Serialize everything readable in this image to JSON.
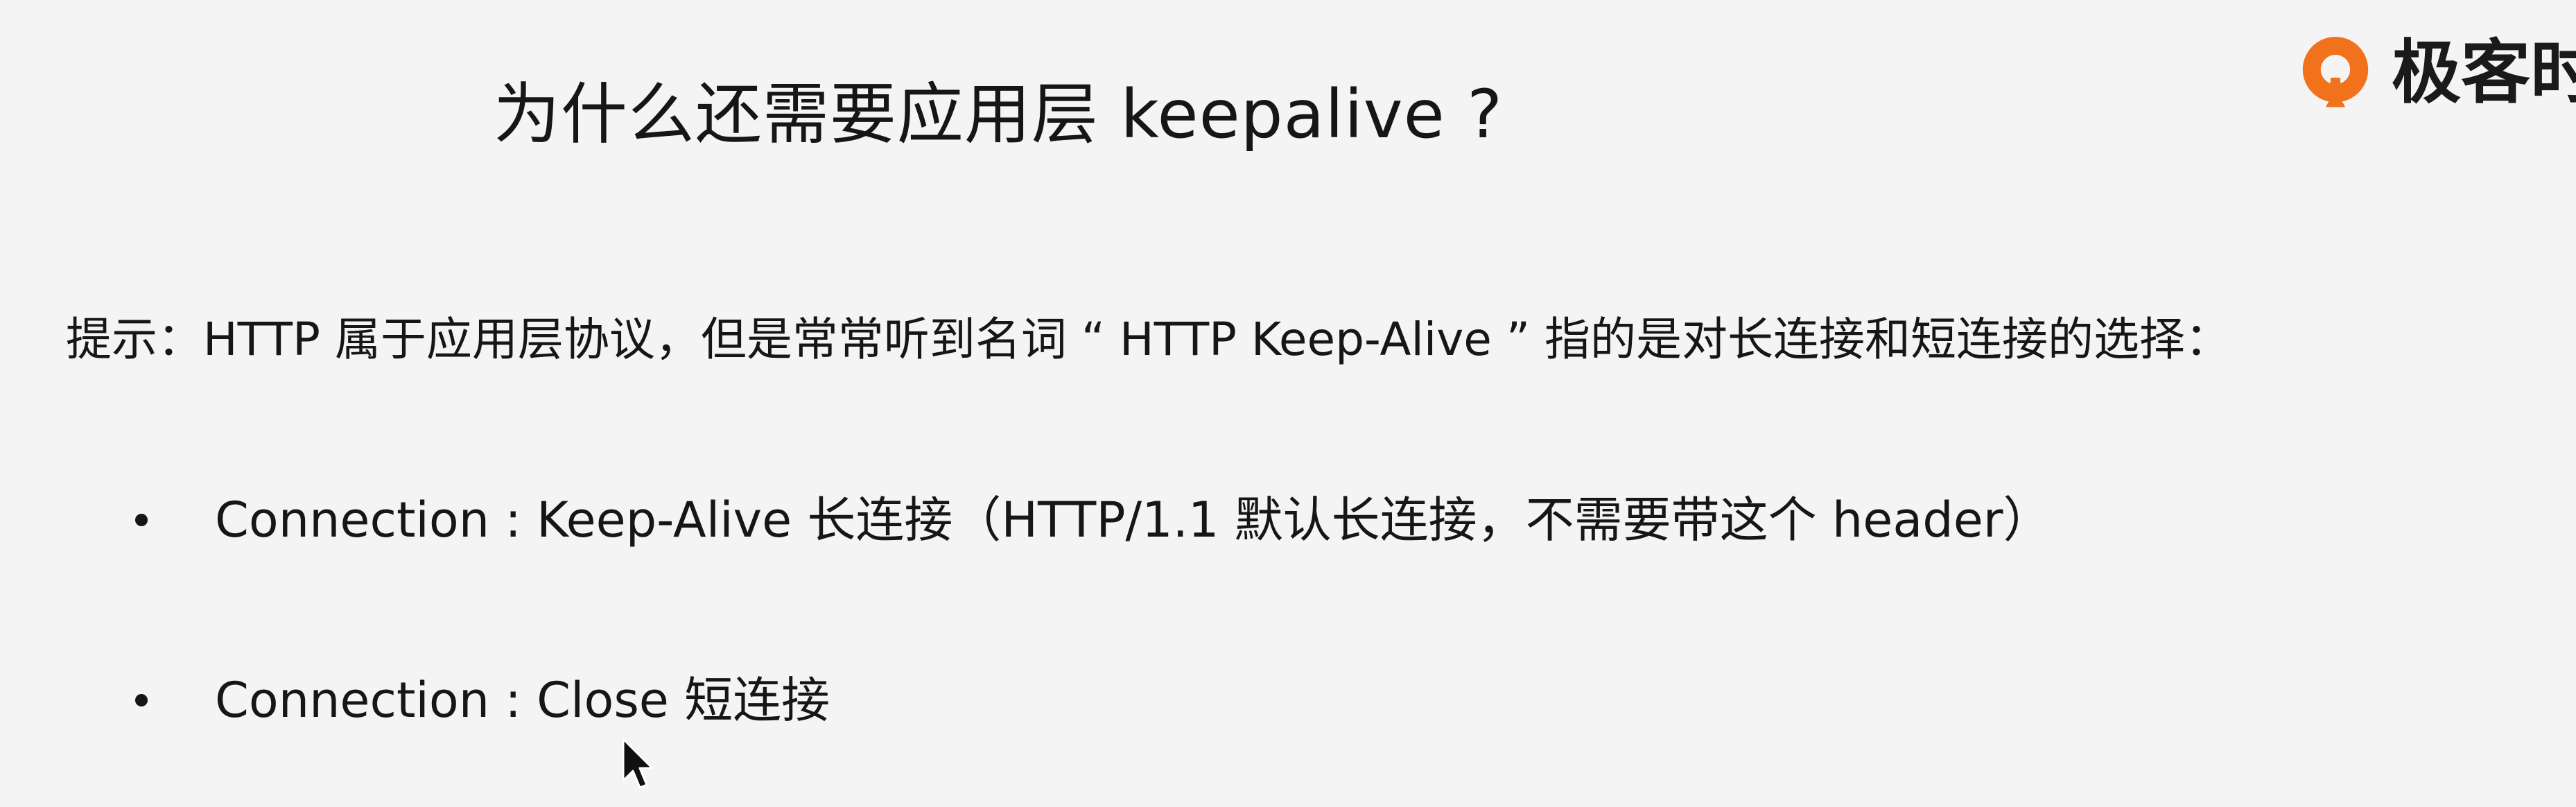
{
  "slide": {
    "title": "为什么还需要应用层 keepalive ?",
    "hint": "提示：HTTP 属于应用层协议，但是常常听到名词 “ HTTP Keep-Alive ” 指的是对长连接和短连接的选择：",
    "bullets": [
      {
        "text": "Connection : Keep-Alive 长连接（HTTP/1.1 默认长连接，不需要带这个 header）"
      },
      {
        "text": "Connection : Close 短连接"
      }
    ]
  },
  "watermark": {
    "text": "极客时间",
    "brand_color": "#f2711c"
  },
  "icons": {
    "logo": "geektime-logo-icon",
    "cursor": "mouse-pointer-icon"
  }
}
